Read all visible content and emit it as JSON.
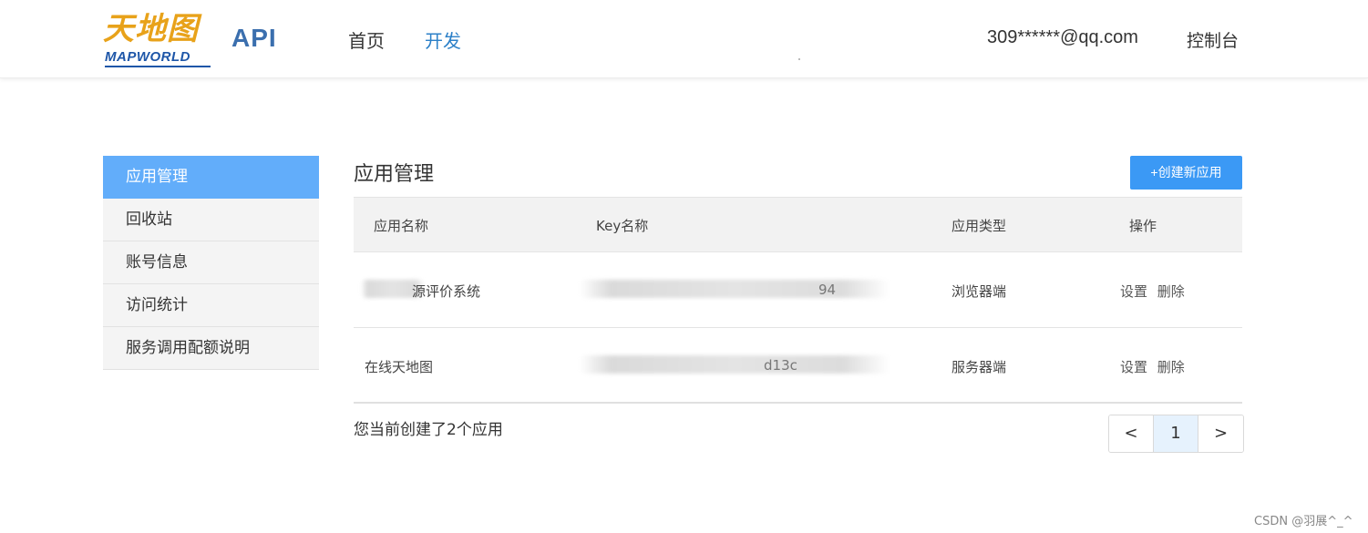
{
  "header": {
    "logo_cn": "天地图",
    "logo_en": "MAPWORLD",
    "api_label": "API",
    "nav": [
      {
        "label": "首页",
        "active": false
      },
      {
        "label": "开发",
        "active": true
      }
    ],
    "user_email": "309******@qq.com",
    "console_label": "控制台"
  },
  "sidebar": {
    "items": [
      {
        "label": "应用管理",
        "active": true
      },
      {
        "label": "回收站",
        "active": false
      },
      {
        "label": "账号信息",
        "active": false
      },
      {
        "label": "访问统计",
        "active": false
      },
      {
        "label": "服务调用配额说明",
        "active": false
      }
    ]
  },
  "main": {
    "title": "应用管理",
    "create_button": "+创建新应用",
    "table": {
      "headers": [
        "应用名称",
        "Key名称",
        "应用类型",
        "操作"
      ],
      "rows": [
        {
          "name": "源评价系统",
          "key": "94",
          "type": "浏览器端",
          "actions": [
            "设置",
            "删除"
          ]
        },
        {
          "name": "在线天地图",
          "key": "d13c",
          "type": "服务器端",
          "actions": [
            "设置",
            "删除"
          ]
        }
      ]
    },
    "summary": "您当前创建了2个应用",
    "pagination": {
      "prev": "<",
      "current": "1",
      "next": ">"
    }
  },
  "watermark": "CSDN @羽展^_^",
  "colors": {
    "accent": "#3b99f5",
    "sidebar_active": "#62adfa",
    "nav_active": "#2c80c8",
    "logo_orange": "#e8a21a",
    "logo_blue": "#1e56a8"
  }
}
